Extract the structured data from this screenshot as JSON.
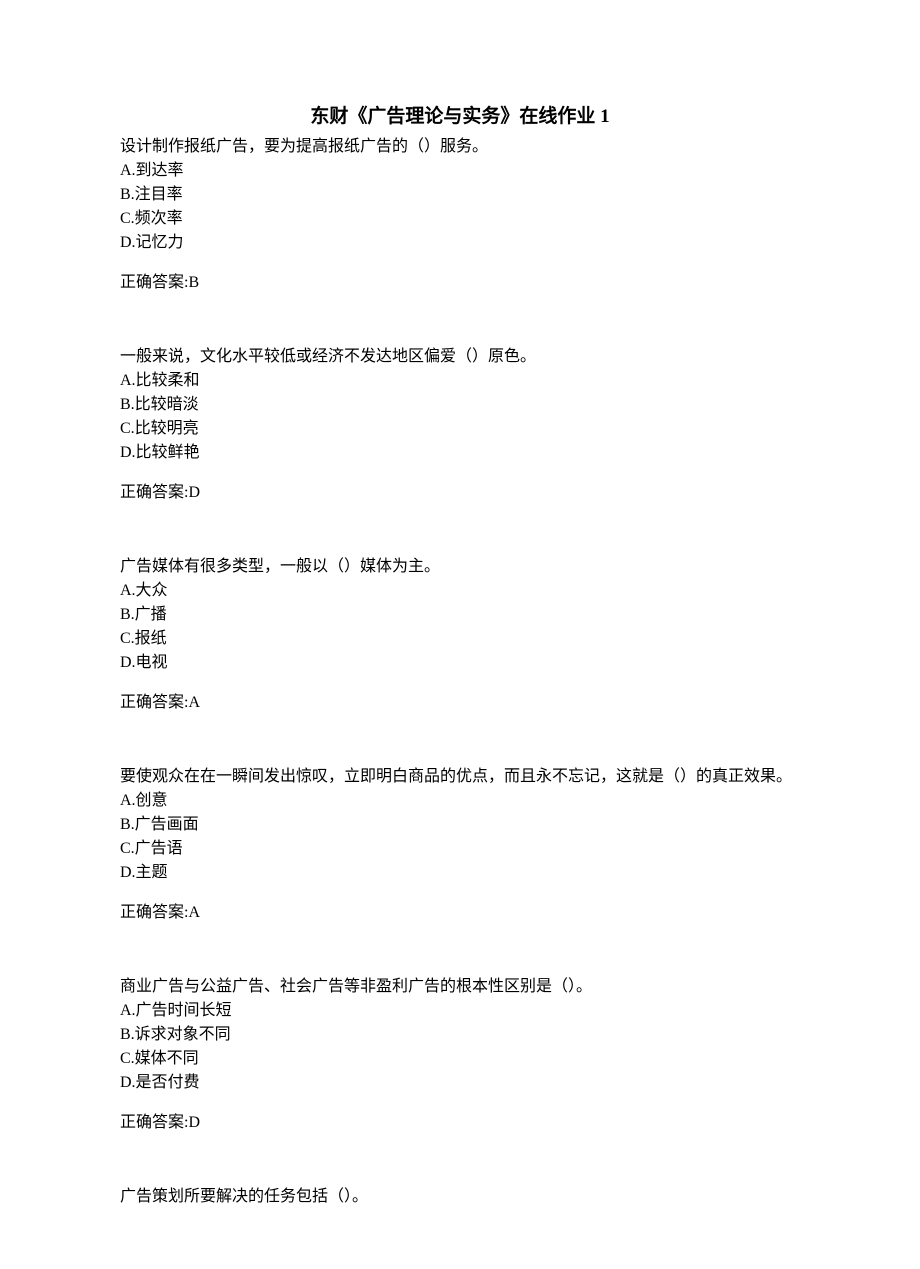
{
  "title": "东财《广告理论与实务》在线作业 1",
  "questions": [
    {
      "text": "设计制作报纸广告，要为提高报纸广告的（）服务。",
      "options": {
        "A": "A.到达率",
        "B": "B.注目率",
        "C": "C.频次率",
        "D": "D.记忆力"
      },
      "answer": "正确答案:B"
    },
    {
      "text": "一般来说，文化水平较低或经济不发达地区偏爱（）原色。",
      "options": {
        "A": "A.比较柔和",
        "B": "B.比较暗淡",
        "C": "C.比较明亮",
        "D": "D.比较鲜艳"
      },
      "answer": "正确答案:D"
    },
    {
      "text": "广告媒体有很多类型，一般以（）媒体为主。",
      "options": {
        "A": "A.大众",
        "B": "B.广播",
        "C": "C.报纸",
        "D": "D.电视"
      },
      "answer": "正确答案:A"
    },
    {
      "text": "要使观众在在一瞬间发出惊叹，立即明白商品的优点，而且永不忘记，这就是（）的真正效果。",
      "options": {
        "A": "A.创意",
        "B": "B.广告画面",
        "C": "C.广告语",
        "D": "D.主题"
      },
      "answer": "正确答案:A"
    },
    {
      "text": "商业广告与公益广告、社会广告等非盈利广告的根本性区别是（）。",
      "options": {
        "A": "A.广告时间长短",
        "B": "B.诉求对象不同",
        "C": "C.媒体不同",
        "D": "D.是否付费"
      },
      "answer": "正确答案:D"
    },
    {
      "text": "广告策划所要解决的任务包括（）。",
      "options": null,
      "answer": null
    }
  ]
}
